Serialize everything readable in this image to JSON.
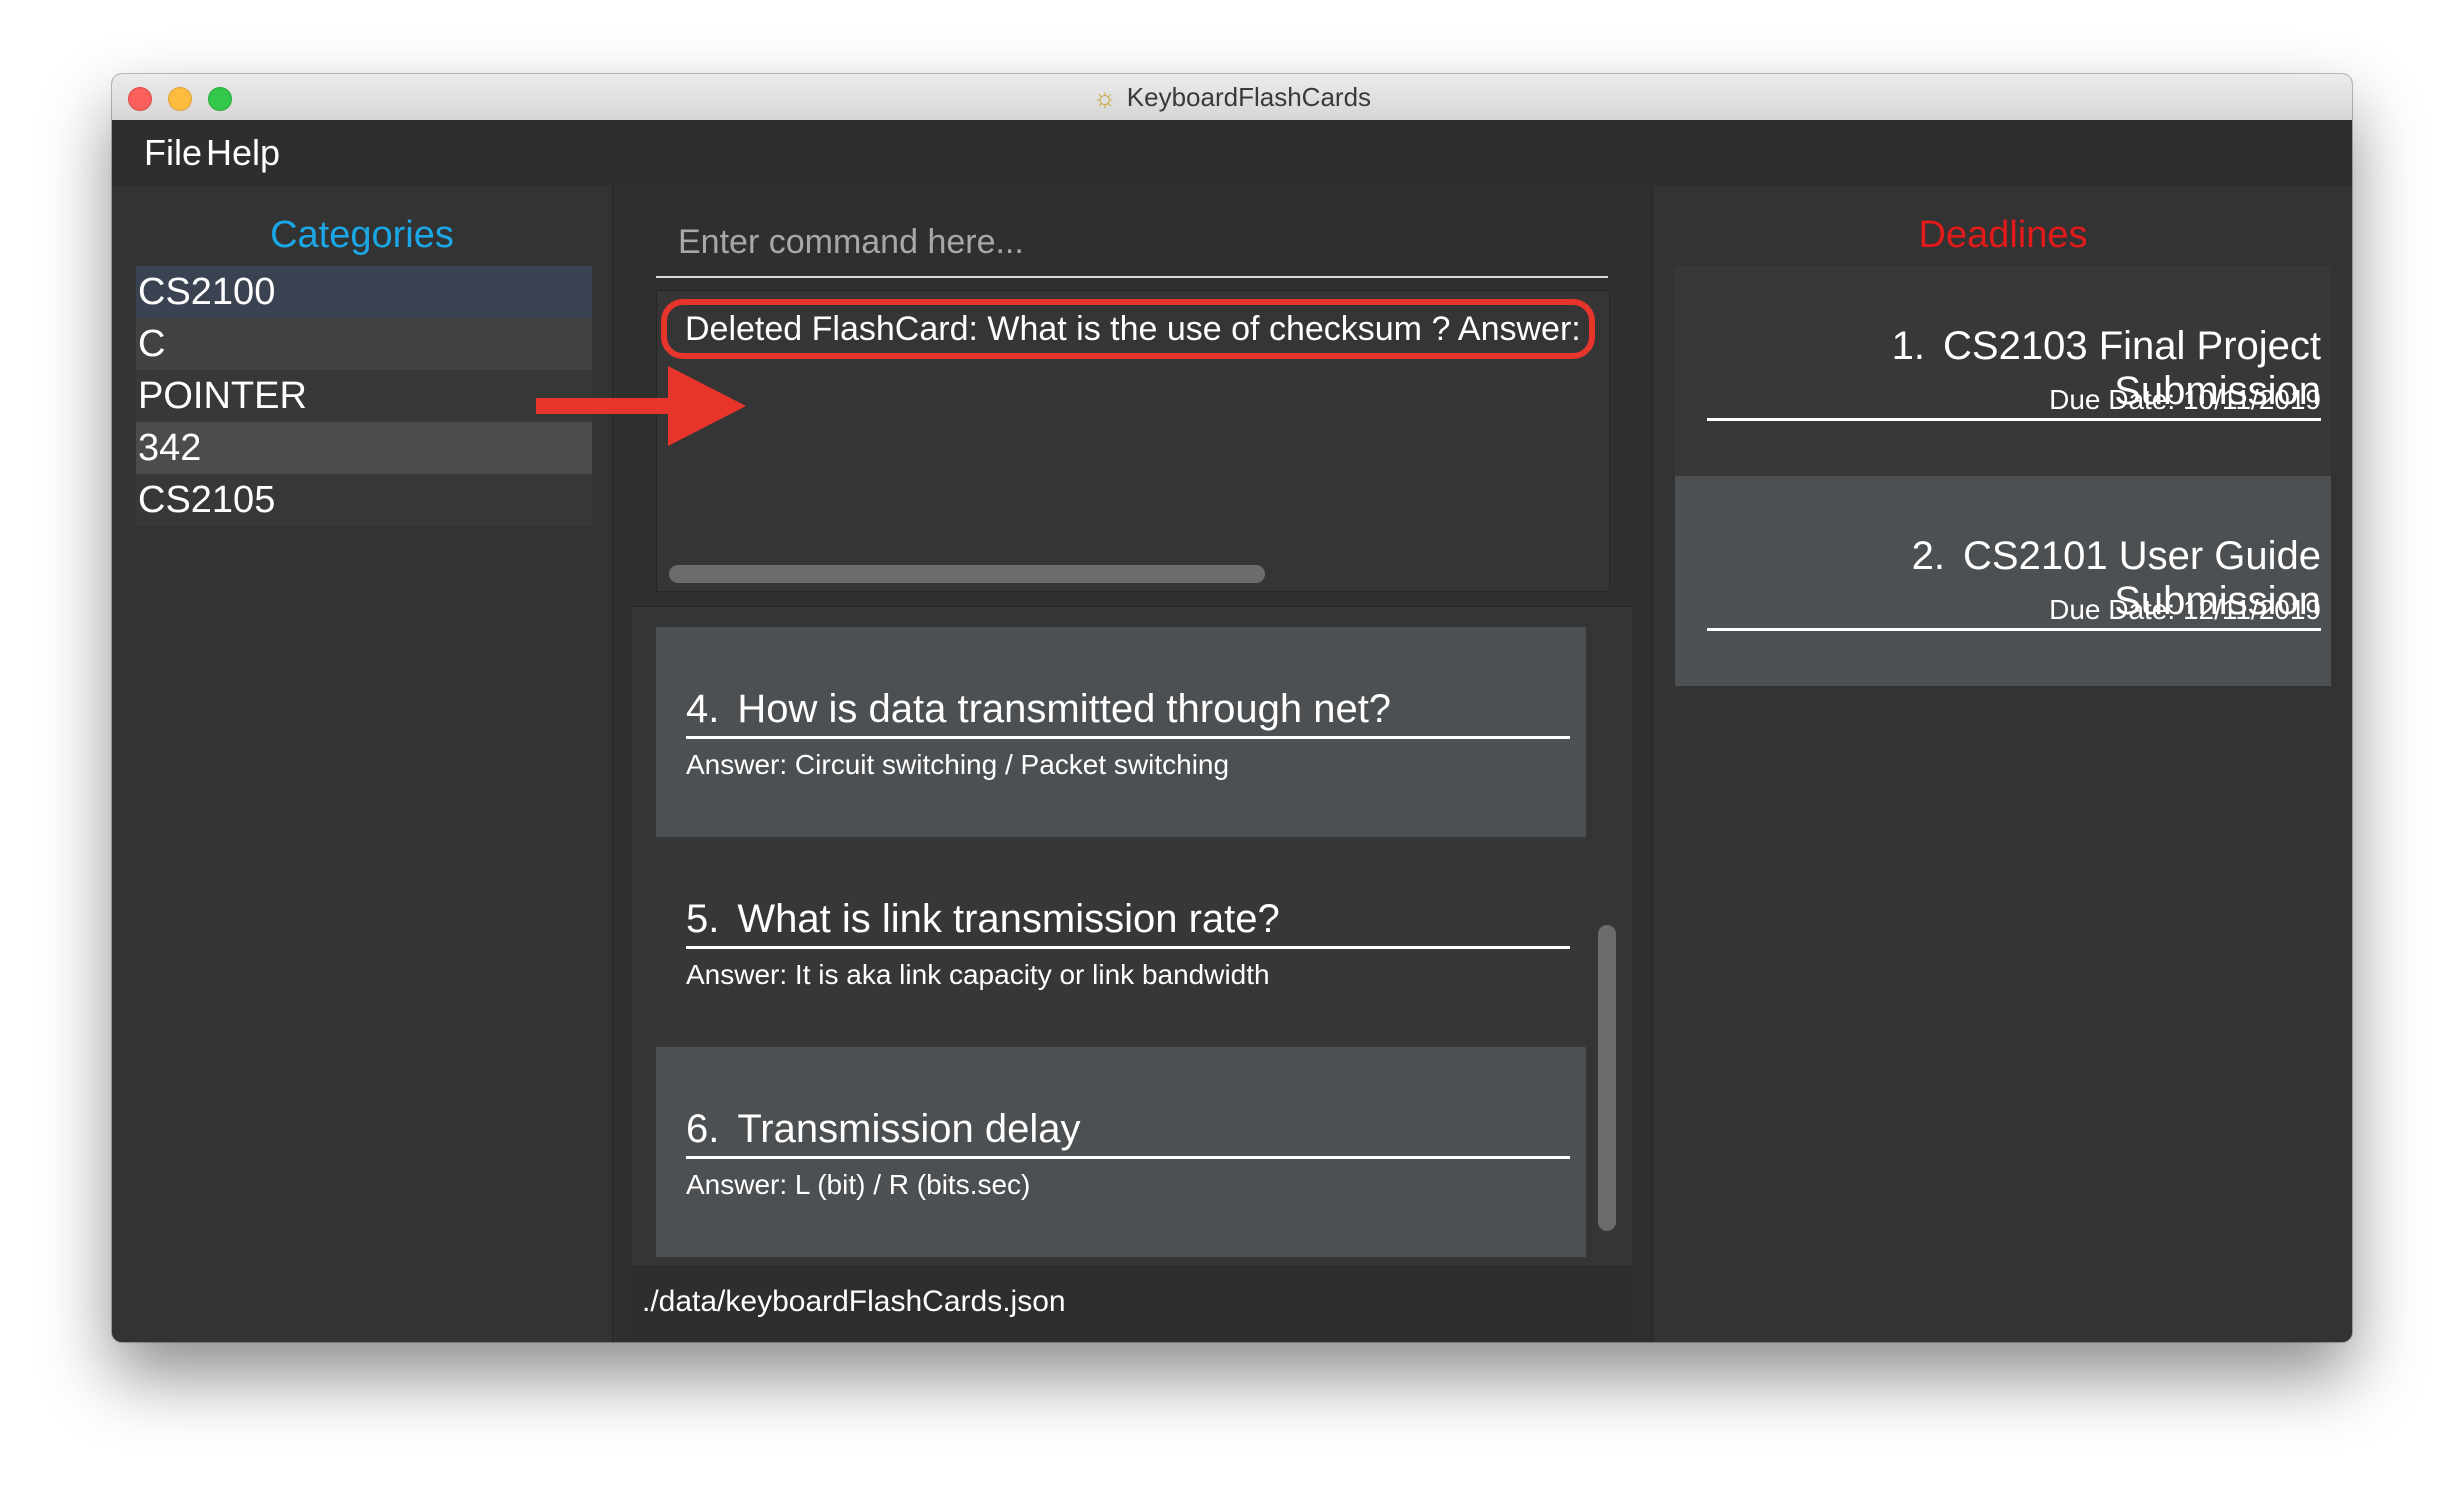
{
  "window": {
    "title": "KeyboardFlashCards",
    "app_icon": "lightbulb-icon"
  },
  "menu": {
    "items": [
      "File",
      "Help"
    ]
  },
  "categories": {
    "title": "Categories",
    "items": [
      "CS2100",
      "C",
      "POINTER",
      "342",
      "CS2105"
    ]
  },
  "command": {
    "placeholder": "Enter command here...",
    "value": ""
  },
  "result": {
    "text": "Deleted FlashCard: What is the use of checksum ? Answer: To detect errors"
  },
  "flashcards": [
    {
      "num": "4.",
      "question": "How is data transmitted through net?",
      "answer": "Answer: Circuit switching / Packet switching"
    },
    {
      "num": "5.",
      "question": "What is link transmission rate?",
      "answer": "Answer: It is aka link capacity or link bandwidth"
    },
    {
      "num": "6.",
      "question": "Transmission delay",
      "answer": "Answer: L (bit) / R (bits.sec)"
    }
  ],
  "status": {
    "path": "./data/keyboardFlashCards.json"
  },
  "deadlines": {
    "title": "Deadlines",
    "items": [
      {
        "num": "1.",
        "name": "CS2103 Final Project Submission",
        "due": "Due Date: 10/11/2019"
      },
      {
        "num": "2.",
        "name": "CS2101 User Guide Submission",
        "due": "Due Date: 12/11/2019"
      }
    ]
  },
  "colors": {
    "categories_title": "#1ba7e6",
    "deadlines_title": "#e21a1a",
    "highlight": "#e8352c",
    "annotation_arrow": "#e8352c"
  }
}
